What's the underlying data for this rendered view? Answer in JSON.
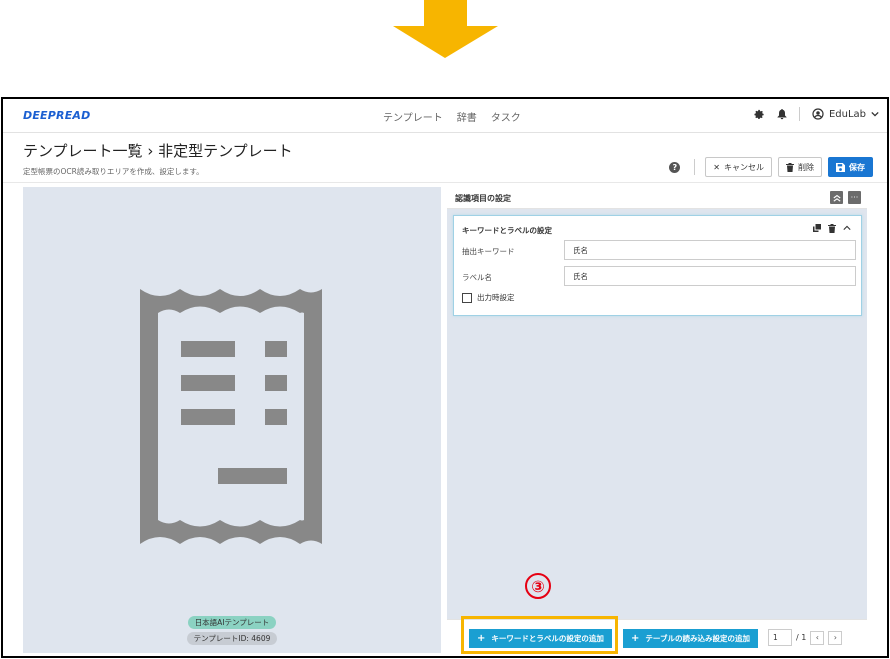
{
  "brand": "DEEPREAD",
  "nav": {
    "items": [
      "テンプレート",
      "辞書",
      "タスク"
    ]
  },
  "user": {
    "name": "EduLab"
  },
  "header": {
    "title": "テンプレート一覧 › 非定型テンプレート",
    "subtitle": "定型帳票のOCR読み取りエリアを作成、設定します。",
    "cancel_label": "キャンセル",
    "delete_label": "削除",
    "save_label": "保存"
  },
  "left_panel": {
    "badge_language": "日本語AIテンプレート",
    "badge_template_id": "テンプレートID: 4609"
  },
  "right_panel": {
    "title": "認識項目の設定",
    "card": {
      "title": "キーワードとラベルの設定",
      "keyword_label": "抽出キーワード",
      "keyword_value": "氏名",
      "label_label": "ラベル名",
      "label_value": "氏名",
      "output_checkbox_label": "出力時設定",
      "output_checked": false
    },
    "footer": {
      "add_keyword_label": "キーワードとラベルの設定の追加",
      "add_table_label": "テーブルの読み込み設定の追加",
      "page_current": "1",
      "page_total": "/ 1"
    }
  },
  "annotation": {
    "step_marker": "③"
  },
  "colors": {
    "accent": "#1976d2",
    "highlight": "#f7b500",
    "arrow": "#f7b500",
    "step": "#e60012"
  },
  "icons": [
    "down-arrow-icon",
    "gear-icon",
    "bell-icon",
    "user-circle-icon",
    "chevron-down-icon",
    "help-icon",
    "close-icon",
    "trash-icon",
    "save-icon",
    "receipt-icon",
    "collapse-icon",
    "more-icon",
    "copy-icon",
    "chevron-up-icon",
    "plus-icon",
    "chevron-left-icon",
    "chevron-right-icon"
  ]
}
